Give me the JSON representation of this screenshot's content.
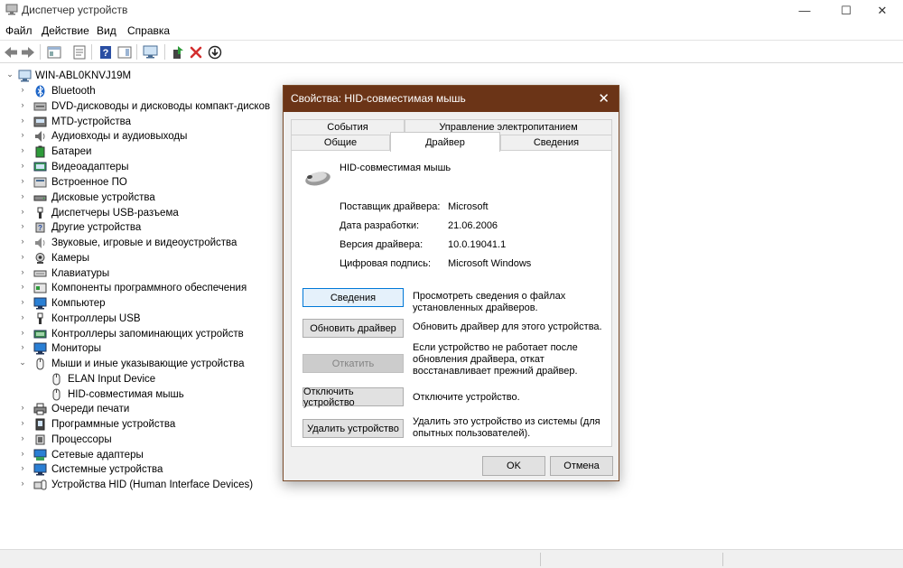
{
  "window": {
    "title": "Диспетчер устройств",
    "controls": {
      "minimize": "—",
      "maximize": "☐",
      "close": "✕"
    }
  },
  "menu": [
    "Файл",
    "Действие",
    "Вид",
    "Справка"
  ],
  "tree": {
    "root": "WIN-ABL0KNVJ19M",
    "items": [
      {
        "label": "Bluetooth",
        "icon": "bluetooth-icon"
      },
      {
        "label": "DVD-дисководы и дисководы компакт-дисков",
        "icon": "dvd-icon"
      },
      {
        "label": "MTD-устройства",
        "icon": "mtd-icon"
      },
      {
        "label": "Аудиовходы и аудиовыходы",
        "icon": "speaker-icon"
      },
      {
        "label": "Батареи",
        "icon": "battery-icon"
      },
      {
        "label": "Видеоадаптеры",
        "icon": "display-adapter-icon"
      },
      {
        "label": "Встроенное ПО",
        "icon": "firmware-icon"
      },
      {
        "label": "Дисковые устройства",
        "icon": "disk-icon"
      },
      {
        "label": "Диспетчеры USB-разъема",
        "icon": "usb-connector-icon"
      },
      {
        "label": "Другие устройства",
        "icon": "other-devices-icon"
      },
      {
        "label": "Звуковые, игровые и видеоустройства",
        "icon": "sound-icon"
      },
      {
        "label": "Камеры",
        "icon": "camera-icon"
      },
      {
        "label": "Клавиатуры",
        "icon": "keyboard-icon"
      },
      {
        "label": "Компоненты программного обеспечения",
        "icon": "software-component-icon"
      },
      {
        "label": "Компьютер",
        "icon": "computer-icon"
      },
      {
        "label": "Контроллеры USB",
        "icon": "usb-icon"
      },
      {
        "label": "Контроллеры запоминающих устройств",
        "icon": "storage-controller-icon"
      },
      {
        "label": "Мониторы",
        "icon": "monitor-icon"
      },
      {
        "label": "Мыши и иные указывающие устройства",
        "icon": "mouse-icon",
        "expanded": true,
        "children": [
          {
            "label": "ELAN Input Device",
            "icon": "mouse-icon"
          },
          {
            "label": "HID-совместимая мышь",
            "icon": "mouse-icon"
          }
        ]
      },
      {
        "label": "Очереди печати",
        "icon": "printer-icon"
      },
      {
        "label": "Программные устройства",
        "icon": "software-device-icon"
      },
      {
        "label": "Процессоры",
        "icon": "processor-icon"
      },
      {
        "label": "Сетевые адаптеры",
        "icon": "network-adapter-icon"
      },
      {
        "label": "Системные устройства",
        "icon": "system-device-icon"
      },
      {
        "label": "Устройства HID (Human Interface Devices)",
        "icon": "hid-icon"
      }
    ]
  },
  "dialog": {
    "title": "Свойства: HID-совместимая мышь",
    "close": "✕",
    "tabs_back": [
      "События",
      "Управление электропитанием"
    ],
    "tabs_front": [
      "Общие",
      "Драйвер",
      "Сведения"
    ],
    "active_tab": "Драйвер",
    "device_name": "HID-совместимая мышь",
    "fields": [
      {
        "label": "Поставщик драйвера:",
        "value": "Microsoft"
      },
      {
        "label": "Дата разработки:",
        "value": "21.06.2006"
      },
      {
        "label": "Версия драйвера:",
        "value": "10.0.19041.1"
      },
      {
        "label": "Цифровая подпись:",
        "value": "Microsoft Windows"
      }
    ],
    "actions": [
      {
        "button": "Сведения",
        "description": "Просмотреть сведения о файлах установленных драйверов.",
        "state": "focused"
      },
      {
        "button": "Обновить драйвер",
        "description": "Обновить драйвер для этого устройства.",
        "state": "normal"
      },
      {
        "button": "Откатить",
        "description": "Если устройство не работает после обновления драйвера, откат восстанавливает прежний драйвер.",
        "state": "disabled"
      },
      {
        "button": "Отключить устройство",
        "description": "Отключите устройство.",
        "state": "normal"
      },
      {
        "button": "Удалить устройство",
        "description": "Удалить это устройство из системы (для опытных пользователей).",
        "state": "normal"
      }
    ],
    "ok": "OK",
    "cancel": "Отмена"
  },
  "colors": {
    "dialog_title_bg": "#6b3417",
    "focus_border": "#0078d7",
    "delete_red": "#d32f2f",
    "enable_green": "#2e9b3a"
  }
}
